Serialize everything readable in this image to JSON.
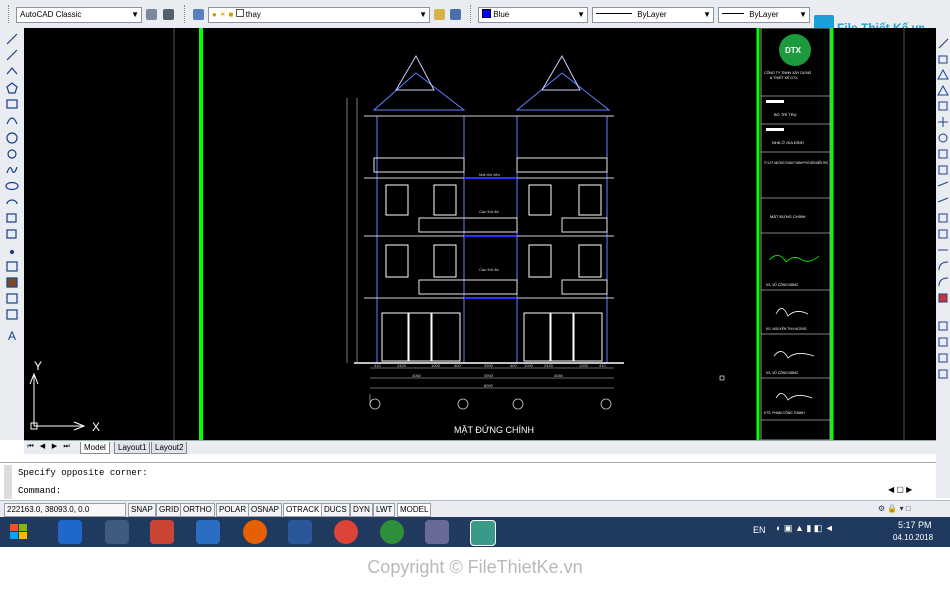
{
  "toolbar": {
    "workspace": "AutoCAD Classic",
    "layer": "thay",
    "color": "Blue",
    "linetype": "ByLayer",
    "lineweight": "ByLayer"
  },
  "watermark_logo": "File Thiết Kế.vn",
  "drawing": {
    "title": "MẶT ĐỨNG CHÍNH",
    "ucs_x": "X",
    "ucs_y": "Y",
    "dims_bottom": [
      "410",
      "2420",
      "1000",
      "400",
      "3900",
      "400",
      "1000",
      "2420",
      "1200",
      "410"
    ],
    "dims_total": [
      "4060",
      "4060",
      "3900",
      "8000"
    ],
    "labels_small": [
      "Cầu thủ đá",
      "Cầu thủ đá",
      "Mái tôn dẻo"
    ]
  },
  "titleblock": {
    "company_line1": "CÔNG TY TNHH XÂY DỰNG",
    "company_line2": "& THIẾT KẾ DTX",
    "project_label": "BỔ TRÍ TRỤ",
    "owner_label": "NHÀ Ở GIA ĐÌNH",
    "address": "TỔ 12 P. MƯỜNG THANH THÀNH PHỐ ĐIỆN BIÊN PHỦ",
    "drawing_name": "MẶT ĐỨNG CHÍNH",
    "sign1": "KS. VŨ CÔNG ĐẰNG",
    "sign2": "KS. NGUYỄN THỊ HƯƠNG",
    "sign3": "KS. VŨ CÔNG ĐẰNG",
    "sign4": "KTS. PHẠM CÔNG THÀNH"
  },
  "layout_tabs": [
    "Model",
    "Layout1",
    "Layout2"
  ],
  "command": {
    "line1": "Specify opposite corner:",
    "prompt": "Command:"
  },
  "status": {
    "coords": "222163.0, 38093.0, 0.0",
    "buttons": [
      "SNAP",
      "GRID",
      "ORTHO",
      "POLAR",
      "OSNAP",
      "OTRACK",
      "DUCS",
      "DYN",
      "LWT",
      "MODEL"
    ]
  },
  "taskbar": {
    "lang": "EN",
    "time": "5:17 PM",
    "date": "04.10.2018"
  },
  "copyright": "Copyright © FileThietKe.vn"
}
